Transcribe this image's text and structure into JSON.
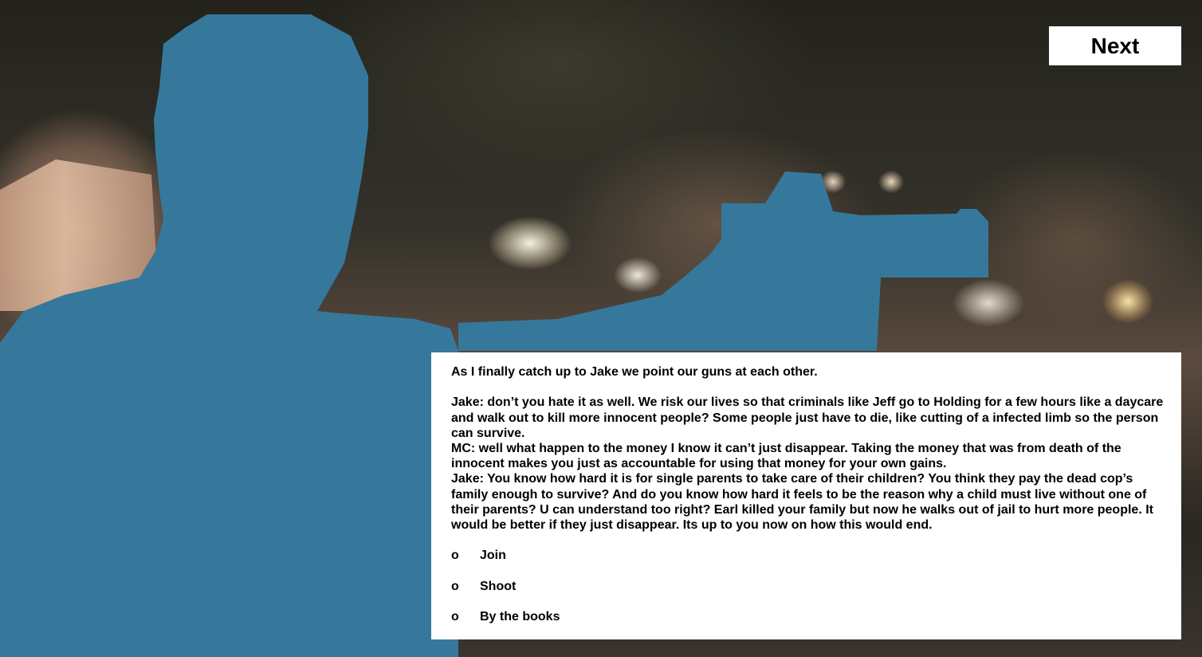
{
  "next_button": {
    "label": "Next"
  },
  "dialog": {
    "intro": "As I finally catch up to Jake we point our guns at each other.",
    "lines": [
      "Jake: don’t you hate it as well. We risk our lives so that criminals like Jeff go to Holding for a few hours like a daycare and walk out to kill more innocent people? Some people just have to die, like cutting of a infected limb so the person can survive.",
      "MC: well what happen to the money I know it can’t just disappear. Taking the money that was from death of the innocent makes you just as accountable for using that money for your own gains.",
      "Jake: You know how hard it is for single parents to take care of their children? You think they pay the dead cop’s family enough to survive? And do you know how hard it feels to be the reason why a child must live without one of their parents? U can understand too right? Earl killed your family but now he walks out of jail to hurt more people. It would be better if they just disappear. Its up to you now on how this would end."
    ]
  },
  "choices": [
    {
      "bullet": "o",
      "label": "Join"
    },
    {
      "bullet": "o",
      "label": "Shoot"
    },
    {
      "bullet": "o",
      "label": "By the books"
    }
  ],
  "colors": {
    "silhouette": "#36789c",
    "panel": "#ffffff",
    "text": "#000000"
  }
}
